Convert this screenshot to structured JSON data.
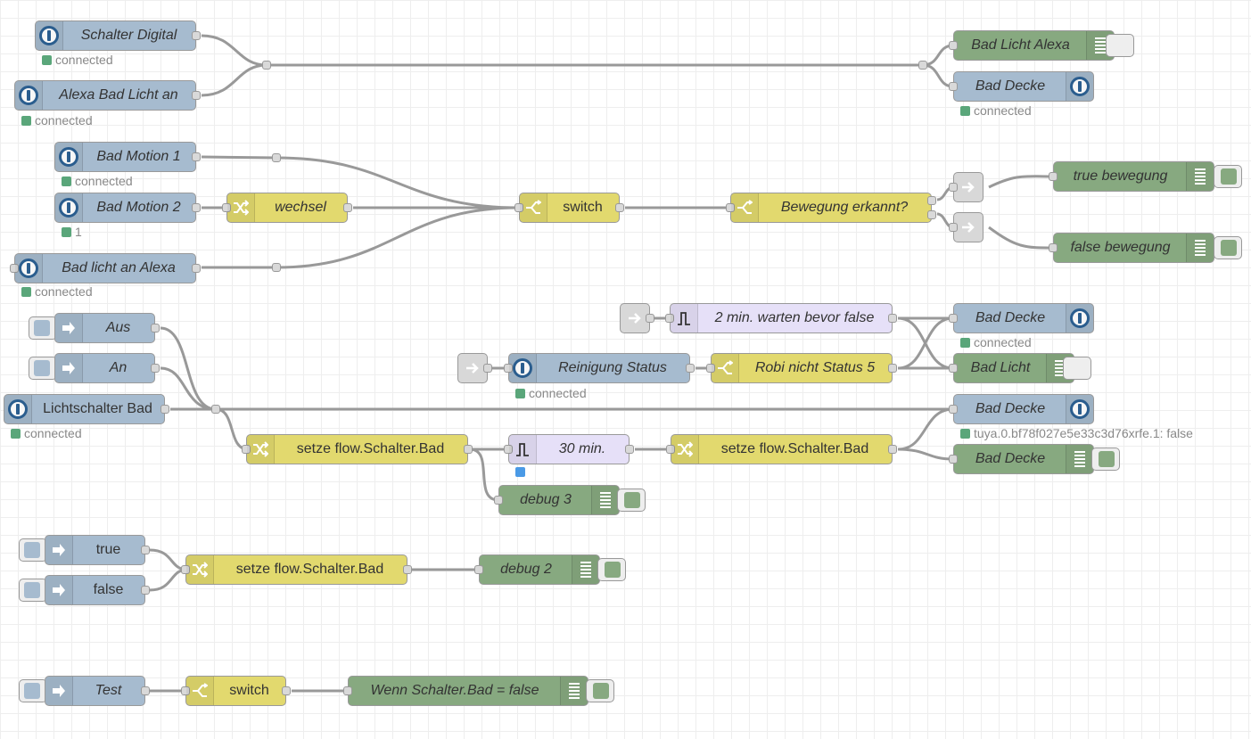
{
  "flow": {
    "status_connected": "connected",
    "nodes": {
      "schalter_digital": "Schalter Digital",
      "alexa_bad_licht_an": "Alexa Bad Licht an",
      "bad_licht_alexa": "Bad Licht Alexa",
      "bad_decke_1": "Bad Decke",
      "bad_motion_1": "Bad Motion 1",
      "bad_motion_2": "Bad Motion 2",
      "bad_licht_an_alexa": "Bad licht an Alexa",
      "wechsel": "wechsel",
      "switch_1": "switch",
      "bewegung_erkannt": "Bewegung erkannt?",
      "true_bewegung": "true bewegung",
      "false_bewegung": "false bewegung",
      "warten": "2 min. warten bevor false",
      "bad_decke_2": "Bad Decke",
      "reinigung_status": "Reinigung Status",
      "robi_status": "Robi nicht Status 5",
      "bad_licht": "Bad Licht",
      "aus": "Aus",
      "an": "An",
      "lichtschalter_bad": "Lichtschalter Bad",
      "bad_decke_3": "Bad Decke",
      "setze_1": "setze flow.Schalter.Bad",
      "delay_30": "30 min.",
      "setze_2": "setze flow.Schalter.Bad",
      "bad_decke_4": "Bad Decke",
      "debug_3": "debug 3",
      "true": "true",
      "false": "false",
      "setze_3": "setze flow.Schalter.Bad",
      "debug_2": "debug 2",
      "test": "Test",
      "switch_2": "switch",
      "wenn_schalter": "Wenn Schalter.Bad = false"
    },
    "status": {
      "bad_motion_2": "1",
      "bad_decke_3": "tuya.0.bf78f027e5e33c3d76xrfe.1: false"
    }
  },
  "colors": {
    "iobroker_node": "#a6bbcf",
    "function_node": "#e2d96e",
    "debug_node": "#87a980",
    "delay_node": "#e6e0f8",
    "status_connected": "#5aa67a",
    "wire": "#999999"
  }
}
